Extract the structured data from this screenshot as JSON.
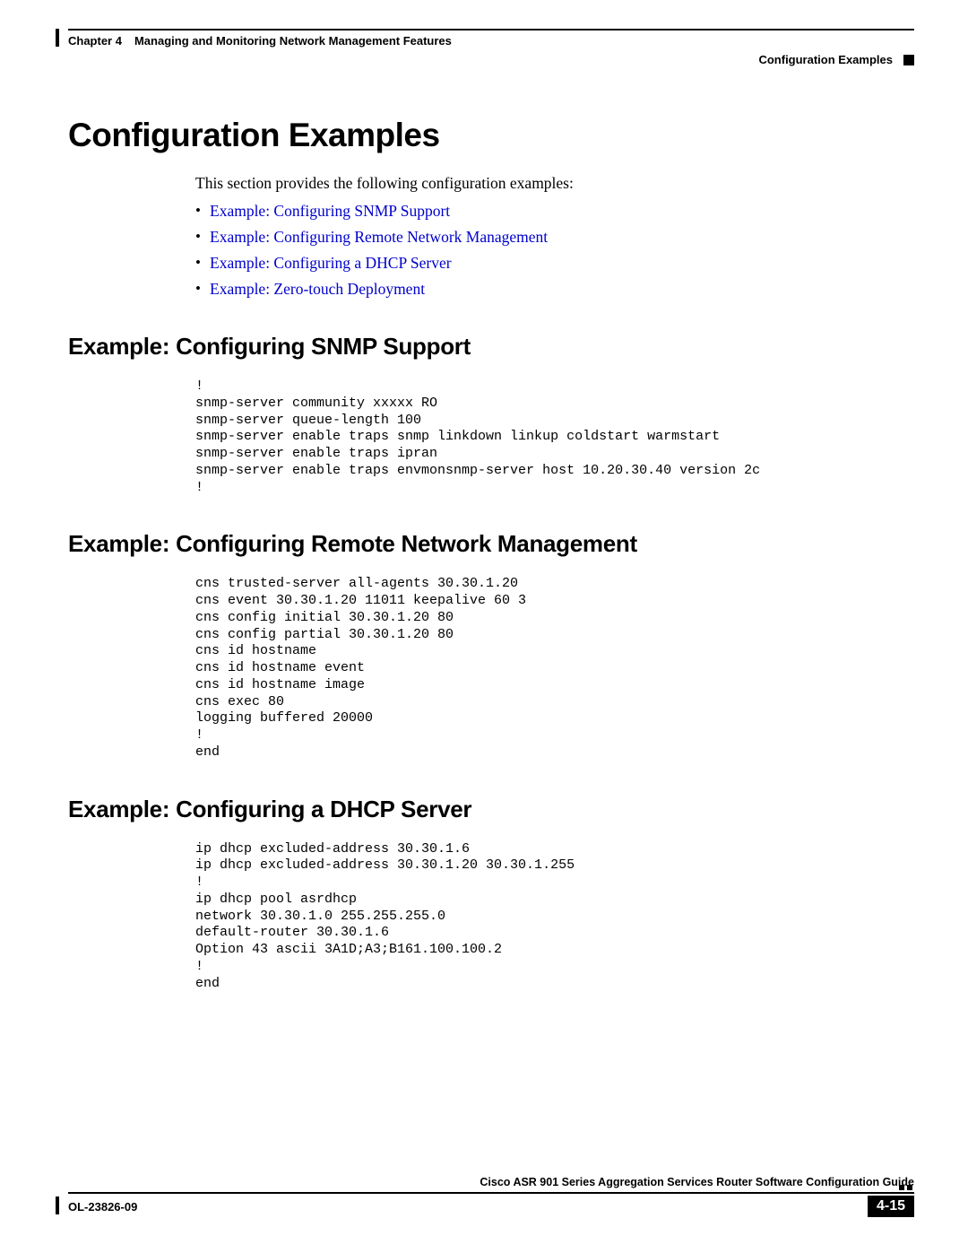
{
  "header": {
    "chapter": "Chapter 4",
    "chapterTitle": "Managing and Monitoring Network Management Features",
    "section": "Configuration Examples"
  },
  "title": "Configuration Examples",
  "intro": "This section provides the following configuration examples:",
  "links": [
    "Example: Configuring SNMP Support",
    "Example: Configuring Remote Network Management",
    "Example: Configuring a DHCP Server",
    "Example: Zero-touch Deployment"
  ],
  "sections": [
    {
      "heading": "Example: Configuring SNMP Support",
      "code": "!\nsnmp-server community xxxxx RO\nsnmp-server queue-length 100\nsnmp-server enable traps snmp linkdown linkup coldstart warmstart\nsnmp-server enable traps ipran\nsnmp-server enable traps envmonsnmp-server host 10.20.30.40 version 2c\n!"
    },
    {
      "heading": "Example: Configuring Remote Network Management",
      "code": "cns trusted-server all-agents 30.30.1.20\ncns event 30.30.1.20 11011 keepalive 60 3\ncns config initial 30.30.1.20 80\ncns config partial 30.30.1.20 80\ncns id hostname\ncns id hostname event\ncns id hostname image\ncns exec 80\nlogging buffered 20000\n!\nend"
    },
    {
      "heading": "Example: Configuring a DHCP Server",
      "code": "ip dhcp excluded-address 30.30.1.6\nip dhcp excluded-address 30.30.1.20 30.30.1.255\n!\nip dhcp pool asrdhcp\nnetwork 30.30.1.0 255.255.255.0\ndefault-router 30.30.1.6\nOption 43 ascii 3A1D;A3;B161.100.100.2\n!\nend"
    }
  ],
  "footer": {
    "guide": "Cisco ASR 901 Series Aggregation Services Router Software Configuration Guide",
    "docId": "OL-23826-09",
    "page": "4-15"
  }
}
